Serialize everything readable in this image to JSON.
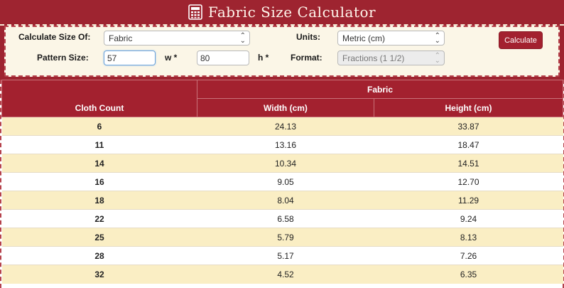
{
  "title": "Fabric Size Calculator",
  "form": {
    "calc_size_label": "Calculate Size Of:",
    "calc_size_value": "Fabric",
    "units_label": "Units:",
    "units_value": "Metric (cm)",
    "pattern_size_label": "Pattern Size:",
    "width_value": "57",
    "w_label": "w *",
    "height_value": "80",
    "h_label": "h *",
    "format_label": "Format:",
    "format_value": "Fractions (1 1/2)",
    "calculate_label": "Calculate"
  },
  "table": {
    "group_header": "Fabric",
    "col_count": "Cloth Count",
    "col_width": "Width (cm)",
    "col_height": "Height (cm)",
    "rows": [
      {
        "count": "6",
        "width": "24.13",
        "height": "33.87"
      },
      {
        "count": "11",
        "width": "13.16",
        "height": "18.47"
      },
      {
        "count": "14",
        "width": "10.34",
        "height": "14.51"
      },
      {
        "count": "16",
        "width": "9.05",
        "height": "12.70"
      },
      {
        "count": "18",
        "width": "8.04",
        "height": "11.29"
      },
      {
        "count": "22",
        "width": "6.58",
        "height": "9.24"
      },
      {
        "count": "25",
        "width": "5.79",
        "height": "8.13"
      },
      {
        "count": "28",
        "width": "5.17",
        "height": "7.26"
      },
      {
        "count": "32",
        "width": "4.52",
        "height": "6.35"
      }
    ]
  },
  "colors": {
    "brand": "#9e2430",
    "panel_bg": "#fbf6e7",
    "row_alt": "#faeec4"
  },
  "icons": {
    "title_icon": "calculator-icon",
    "select_icon": "chevron-up-down-icon"
  }
}
